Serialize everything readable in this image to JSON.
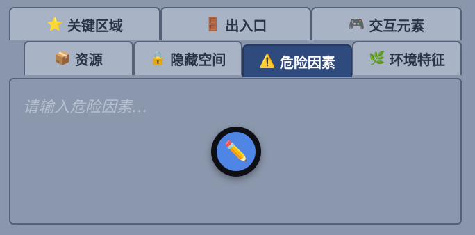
{
  "tabs_row1": [
    {
      "icon": "star-icon",
      "glyph": "⭐",
      "label": "关键区域"
    },
    {
      "icon": "door-icon",
      "glyph": "🚪",
      "label": "出入口"
    },
    {
      "icon": "game-controller-icon",
      "glyph": "🎮",
      "label": "交互元素"
    }
  ],
  "tabs_row2": [
    {
      "icon": "package-icon",
      "glyph": "📦",
      "label": "资源"
    },
    {
      "icon": "lock-icon",
      "glyph": "🔒",
      "label": "隐藏空间"
    },
    {
      "icon": "warning-icon",
      "glyph": "⚠️",
      "label": "危险因素",
      "active": true
    },
    {
      "icon": "herb-icon",
      "glyph": "🌿",
      "label": "环境特征"
    }
  ],
  "editor": {
    "placeholder": "请输入危险因素...",
    "edit_icon": "pencil-icon",
    "edit_glyph": "✏️"
  },
  "colors": {
    "background": "#8a96ab",
    "tab": "#a8b3c5",
    "active_tab": "#2f4a7c",
    "edit_button": "#4f86e6"
  }
}
